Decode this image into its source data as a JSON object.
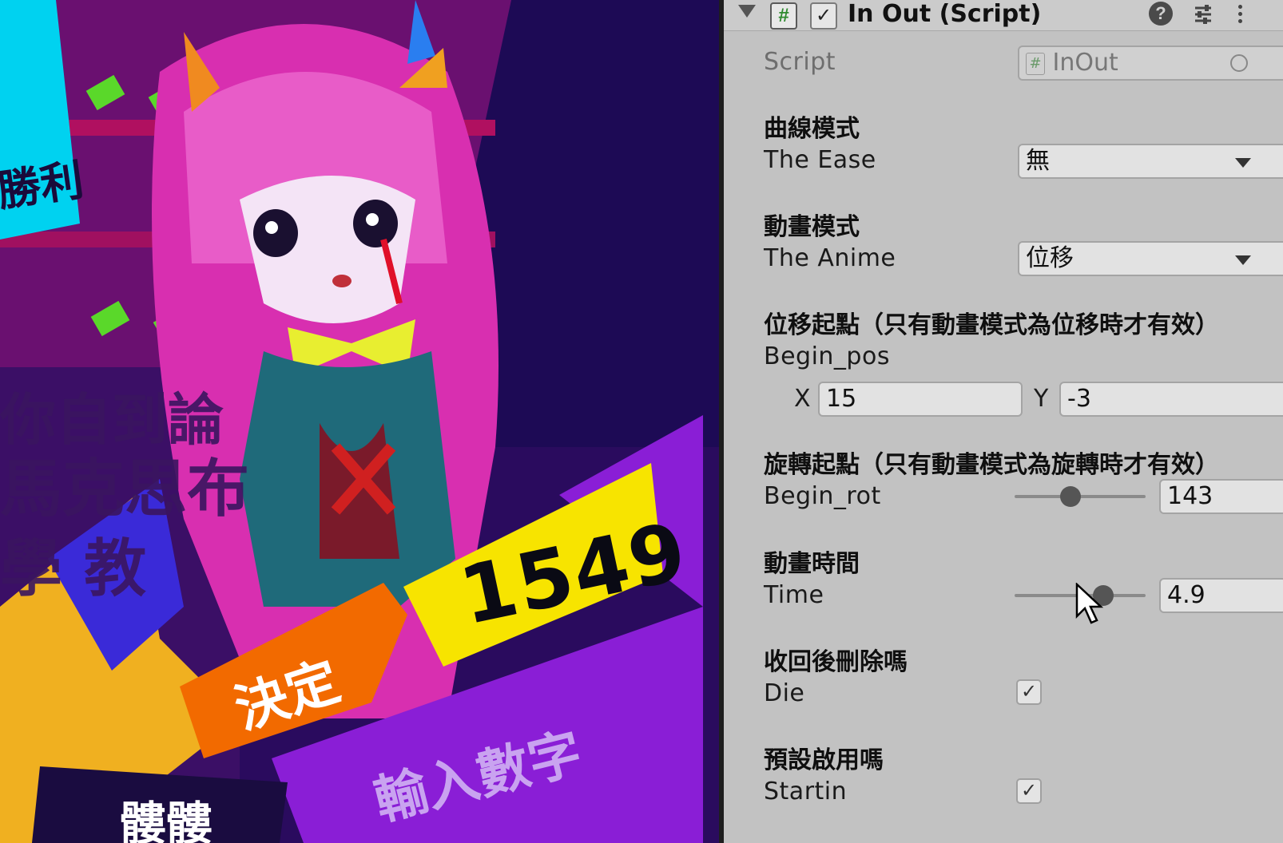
{
  "scene": {
    "win_text": "勝利",
    "bg_text_1": "你自到論",
    "bg_text_2": "馬克思布",
    "bg_text_3": "學  教",
    "score": "1549",
    "confirm_label": "決定",
    "input_label": "輸入數字",
    "name_label": "髏髏"
  },
  "inspector": {
    "component_title": "In Out (Script)",
    "script_icon": "#",
    "enabled_check": "✓",
    "help_icon": "?",
    "script": {
      "label": "Script",
      "value": "InOut",
      "icon": "#"
    },
    "ease": {
      "header": "曲線模式",
      "label": "The Ease",
      "value": "無"
    },
    "anime": {
      "header": "動畫模式",
      "label": "The Anime",
      "value": "位移"
    },
    "begin_pos": {
      "header": "位移起點（只有動畫模式為位移時才有效）",
      "label": "Begin_pos",
      "x_label": "X",
      "x_value": "15",
      "y_label": "Y",
      "y_value": "-3"
    },
    "begin_rot": {
      "header": "旋轉起點（只有動畫模式為旋轉時才有效）",
      "label": "Begin_rot",
      "value": "143"
    },
    "time": {
      "header": "動畫時間",
      "label": "Time",
      "value": "4.9"
    },
    "die": {
      "header": "收回後刪除嗎",
      "label": "Die",
      "checked": "✓"
    },
    "startin": {
      "header": "預設啟用嗎",
      "label": "Startin",
      "checked": "✓"
    }
  },
  "colors": {
    "inspector_bg": "#c2c2c2",
    "score_banner": "#f7e400",
    "confirm_banner": "#f26a00",
    "input_banner": "#8a1ed6",
    "scene_bg": "#2a0b5e"
  }
}
